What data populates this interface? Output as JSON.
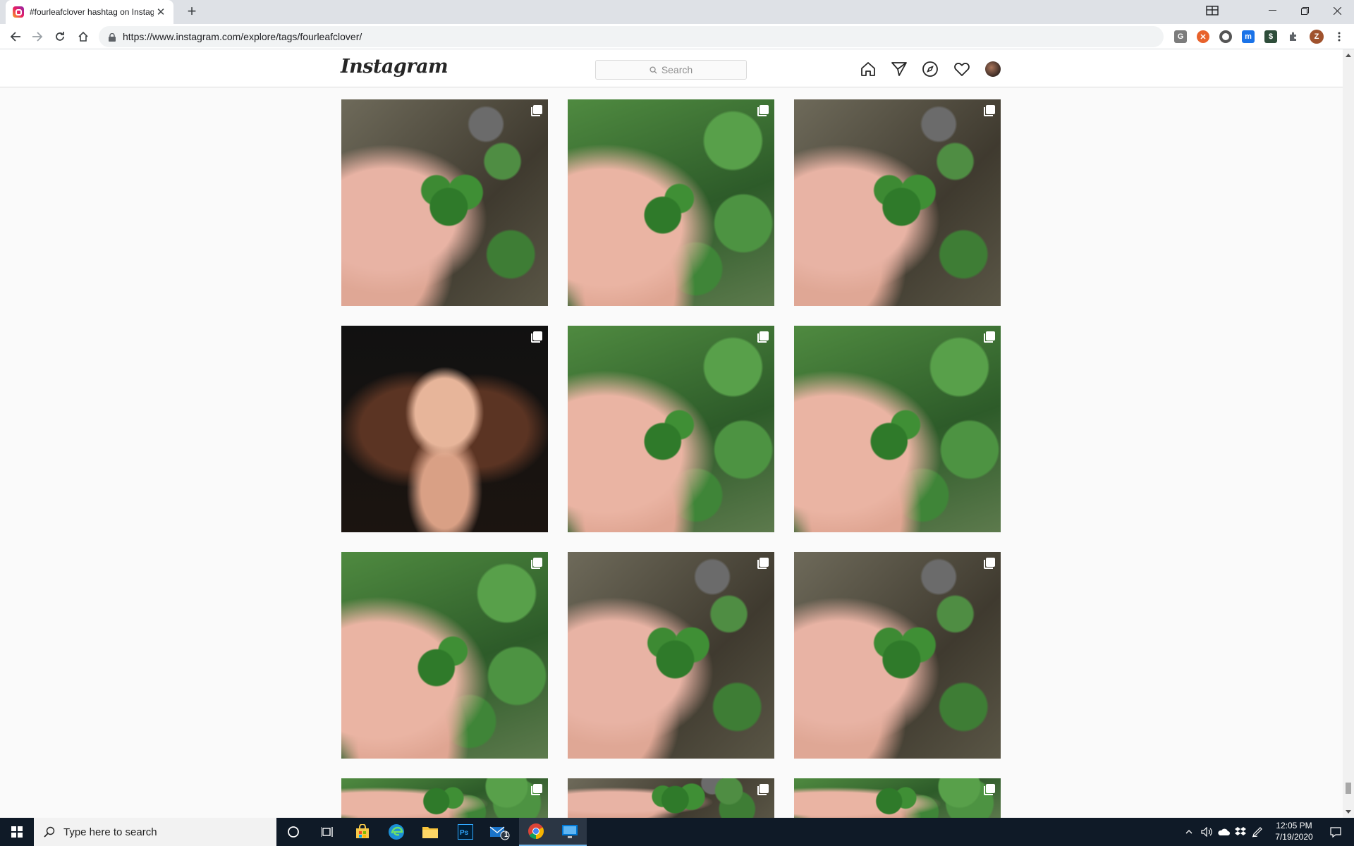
{
  "browser": {
    "tab_title": "#fourleafclover hashtag on Instagram",
    "tab_close": "✕",
    "new_tab": "+",
    "url": "https://www.instagram.com/explore/tags/fourleafclover/",
    "profile_initial": "Z"
  },
  "instagram": {
    "logo": "Instagram",
    "search_placeholder": "Search",
    "posts": [
      {
        "alt": "four leaf clover in hand",
        "multi": true
      },
      {
        "alt": "four leaf clover in hand",
        "multi": true
      },
      {
        "alt": "four leaf clover in hand",
        "multi": true
      },
      {
        "alt": "selfie portrait",
        "multi": true
      },
      {
        "alt": "four leaf clover in hand",
        "multi": true
      },
      {
        "alt": "four leaf clover in hand",
        "multi": true
      },
      {
        "alt": "four leaf clover in hand",
        "multi": true
      },
      {
        "alt": "four leaf clover in hand",
        "multi": true
      },
      {
        "alt": "four leaf clover in hand",
        "multi": true
      },
      {
        "alt": "four leaf clover in hand",
        "multi": true
      },
      {
        "alt": "four leaf clover in hand",
        "multi": true
      },
      {
        "alt": "four leaf clover in hand",
        "multi": true
      }
    ]
  },
  "taskbar": {
    "search_placeholder": "Type here to search",
    "time": "12:05 PM",
    "date": "7/19/2020",
    "mail_badge": "1"
  },
  "colors": {
    "instagram_border": "#dbdbdb",
    "taskbar_bg": "#0f1a27",
    "chrome_tabstrip": "#dee1e6"
  }
}
